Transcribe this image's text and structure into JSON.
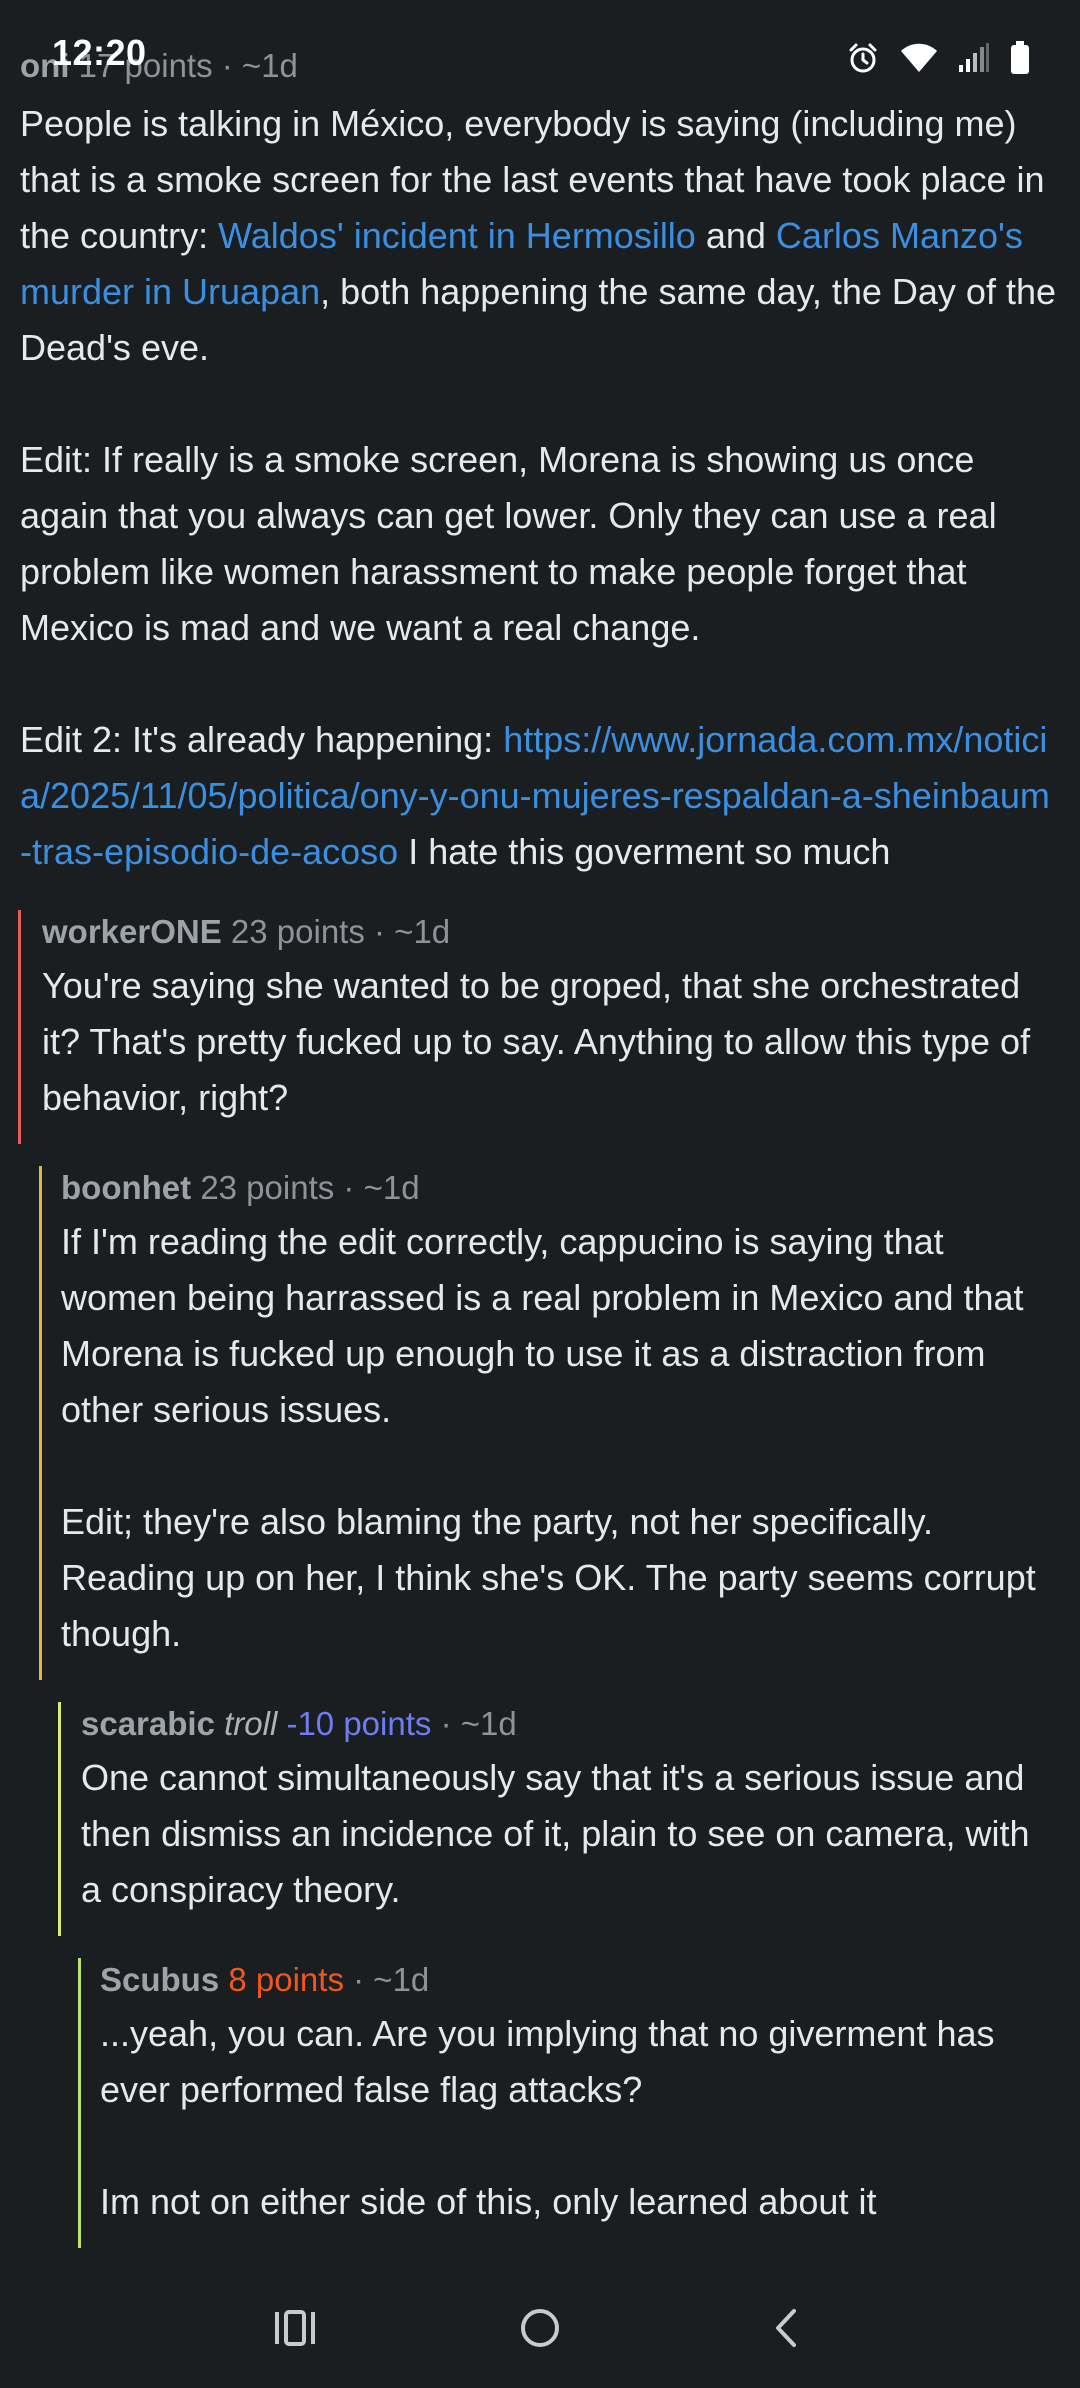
{
  "status_bar": {
    "time": "12:20",
    "icons": [
      "alarm-icon",
      "wifi-icon",
      "signal-icon",
      "battery-icon"
    ]
  },
  "comments": [
    {
      "author": "oni",
      "points": "17 points",
      "age": "· ~1d",
      "paragraphs": {
        "p1_a": "People is talking in México, everybody is saying (including me) that is a smoke screen for the last events that have took place in the country: ",
        "p1_link1": "Waldos' incident in Hermosillo",
        "p1_b": " and ",
        "p1_link2": "Carlos Manzo's murder in Uruapan",
        "p1_c": ", both happening the same day, the Day of the Dead's eve.",
        "p2": "Edit: If really is a smoke screen, Morena is showing us once again that you always can get lower. Only they can use a real problem like women harassment to make people forget that Mexico is mad and we want a real change.",
        "p3_a": "Edit 2: It's already happening: ",
        "p3_link": "https://www.jornada.com.mx/noticia/2025/11/05/politica/ony-y-onu-mujeres-respaldan-a-sheinbaum-tras-episodio-de-acoso",
        "p3_b": " I hate this goverment so much"
      }
    },
    {
      "author": "workerONE",
      "points": "23 points",
      "age": "· ~1d",
      "body": "You're saying she wanted to be groped, that she orchestrated it? That's pretty fucked up to say. Anything to allow this type of behavior, right?"
    },
    {
      "author": "boonhet",
      "points": "23 points",
      "age": "· ~1d",
      "p1": "If I'm reading the edit correctly, cappucino is saying that women being harrassed is a real problem in Mexico and that Morena is fucked up enough to use it as a distraction from other serious issues.",
      "p2": "Edit; they're also blaming the party, not her specifically. Reading up on her, I think she's OK. The party seems corrupt though."
    },
    {
      "author": "scarabic",
      "flair": "troll",
      "points": "-10 points",
      "age": "· ~1d",
      "body": "One cannot simultaneously say that it's a serious issue and then dismiss an incidence of it, plain to see on camera, with a conspiracy theory."
    },
    {
      "author": "Scubus",
      "points": "8 points",
      "age": "· ~1d",
      "p1": "...yeah, you can. Are you implying that no giverment has ever performed false flag attacks?",
      "p2": "Im not on either side of this, only learned about it"
    }
  ],
  "nav_bar": {
    "recents": "recents-icon",
    "home": "home-icon",
    "back": "back-icon"
  },
  "colors": {
    "background": "#1b1e21",
    "link": "#3b8fe0",
    "thread_level_1": "#e85a5a",
    "thread_level_2": "#e3b93c",
    "thread_level_3": "#dbe97c",
    "thread_level_4": "#b9e26b",
    "negative_points": "#6f7cf2",
    "hot_points": "#f0571e"
  }
}
